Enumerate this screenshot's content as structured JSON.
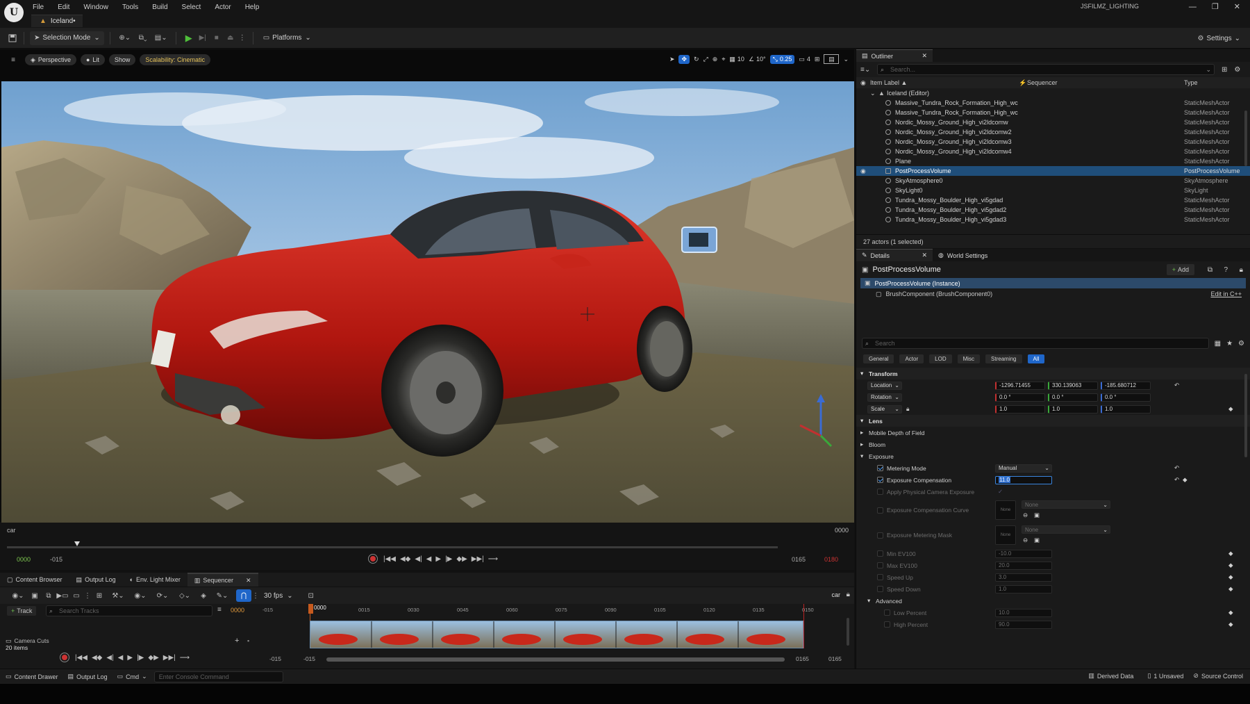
{
  "menubar": {
    "items": [
      "File",
      "Edit",
      "Window",
      "Tools",
      "Build",
      "Select",
      "Actor",
      "Help"
    ],
    "map_tab": "Iceland•",
    "project_name": "JSFILMZ_LIGHTING"
  },
  "toolbar": {
    "selection_mode": "Selection Mode",
    "platforms": "Platforms",
    "settings": "Settings"
  },
  "viewport": {
    "perspective": "Perspective",
    "lit": "Lit",
    "show": "Show",
    "scalability": "Scalability: Cinematic",
    "grid_snap": "10",
    "rot_snap": "10°",
    "scale_snap": "0.25",
    "camera_speed": "4"
  },
  "playback": {
    "track_name": "car",
    "frame_right": "0000",
    "start_frame": "0000",
    "start_neg": "-015",
    "end_frame": "0165",
    "end_red": "0180"
  },
  "lower_tabs": [
    "Content Browser",
    "Output Log",
    "Env. Light Mixer",
    "Sequencer"
  ],
  "sequencer": {
    "fps": "30 fps",
    "seq_name": "car",
    "add_track": "Track",
    "search_placeholder": "Search Tracks",
    "current_frame": "0000",
    "timecode": "0000",
    "ruler_ticks": [
      "-015",
      "0015",
      "0030",
      "0045",
      "0060",
      "0075",
      "0090",
      "0105",
      "0120",
      "0135",
      "0150"
    ],
    "camera_cuts": "Camera Cuts",
    "items_count": "20 items",
    "range_left_a": "-015",
    "range_left_b": "-015",
    "range_right_a": "0165",
    "range_right_b": "0165"
  },
  "status": {
    "content_drawer": "Content Drawer",
    "output_log": "Output Log",
    "cmd": "Cmd",
    "console_placeholder": "Enter Console Command",
    "derived_data": "Derived Data",
    "unsaved": "1 Unsaved",
    "source_control": "Source Control"
  },
  "outliner": {
    "tab": "Outliner",
    "search_placeholder": "Search...",
    "col_label": "Item Label ▲",
    "col_sequencer": "Sequencer",
    "col_type": "Type",
    "root": "Iceland (Editor)",
    "rows": [
      {
        "label": "Massive_Tundra_Rock_Formation_High_wc",
        "type": "StaticMeshActor"
      },
      {
        "label": "Massive_Tundra_Rock_Formation_High_wc",
        "type": "StaticMeshActor"
      },
      {
        "label": "Nordic_Mossy_Ground_High_vi2ldcomw",
        "type": "StaticMeshActor"
      },
      {
        "label": "Nordic_Mossy_Ground_High_vi2ldcomw2",
        "type": "StaticMeshActor"
      },
      {
        "label": "Nordic_Mossy_Ground_High_vi2ldcomw3",
        "type": "StaticMeshActor"
      },
      {
        "label": "Nordic_Mossy_Ground_High_vi2ldcomw4",
        "type": "StaticMeshActor"
      },
      {
        "label": "Plane",
        "type": "StaticMeshActor"
      },
      {
        "label": "PostProcessVolume",
        "type": "PostProcessVolume"
      },
      {
        "label": "SkyAtmosphere0",
        "type": "SkyAtmosphere"
      },
      {
        "label": "SkyLight0",
        "type": "SkyLight"
      },
      {
        "label": "Tundra_Mossy_Boulder_High_vi5gdad",
        "type": "StaticMeshActor"
      },
      {
        "label": "Tundra_Mossy_Boulder_High_vi5gdad2",
        "type": "StaticMeshActor"
      },
      {
        "label": "Tundra_Mossy_Boulder_High_vi5gdad3",
        "type": "StaticMeshActor"
      }
    ],
    "footer": "27 actors (1 selected)"
  },
  "details": {
    "tab": "Details",
    "tab2": "World Settings",
    "actor_name": "PostProcessVolume",
    "add": "Add",
    "instance": "PostProcessVolume (Instance)",
    "component": "BrushComponent (BrushComponent0)",
    "edit_cpp": "Edit in C++",
    "search_placeholder": "Search",
    "filters": [
      "General",
      "Actor",
      "LOD",
      "Misc",
      "Streaming",
      "All"
    ],
    "transform": "Transform",
    "location": "Location",
    "rotation": "Rotation",
    "scale": "Scale",
    "loc": [
      "-1296.71455",
      "330.139063",
      "-185.680712"
    ],
    "rot": [
      "0.0 °",
      "0.0 °",
      "0.0 °"
    ],
    "scl": [
      "1.0",
      "1.0",
      "1.0"
    ],
    "lens": "Lens",
    "mobile_dof": "Mobile Depth of Field",
    "bloom": "Bloom",
    "exposure": "Exposure",
    "metering_mode": "Metering Mode",
    "metering_value": "Manual",
    "exposure_comp": "Exposure Compensation",
    "exposure_comp_value": "11.0",
    "apply_physical": "Apply Physical Camera Exposure",
    "comp_curve": "Exposure Compensation Curve",
    "metering_mask": "Exposure Metering Mask",
    "none": "None",
    "none_b": "None",
    "min_ev": "Min EV100",
    "min_ev_v": "-10.0",
    "max_ev": "Max EV100",
    "max_ev_v": "20.0",
    "speed_up": "Speed Up",
    "speed_up_v": "3.0",
    "speed_down": "Speed Down",
    "speed_down_v": "1.0",
    "advanced": "Advanced",
    "low_pct": "Low Percent",
    "low_pct_v": "10.0",
    "high_pct": "High Percent",
    "high_pct_v": "90.0"
  }
}
